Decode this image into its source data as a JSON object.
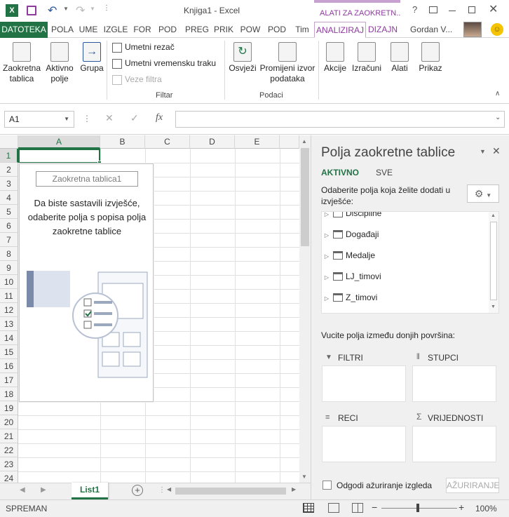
{
  "window": {
    "title": "Knjiga1 - Excel",
    "context_tab_group": "ALATI ZA ZAOKRETN...",
    "user": "Gordan V..."
  },
  "tabs": [
    "DATOTEKA",
    "POLA",
    "UME",
    "IZGLE",
    "FOR",
    "POD",
    "PREG",
    "PRIK",
    "POW",
    "POD",
    "Tim",
    "ANALIZIRAJ",
    "DIZAJN"
  ],
  "ribbon": {
    "pivot_table": "Zaokretna tablica",
    "active_field": "Aktivno polje",
    "group": "Grupa",
    "insert_slicer": "Umetni rezač",
    "insert_timeline": "Umetni vremensku traku",
    "filter_connections": "Veze filtra",
    "filter_group_label": "Filtar",
    "refresh": "Osvježi",
    "change_source": "Promijeni izvor podataka",
    "data_group_label": "Podaci",
    "actions": "Akcije",
    "calculations": "Izračuni",
    "tools": "Alati",
    "show": "Prikaz"
  },
  "formula_bar": {
    "name_box": "A1",
    "fx": "fx",
    "formula": ""
  },
  "grid": {
    "columns": [
      "A",
      "B",
      "C",
      "D",
      "E"
    ],
    "rows": [
      "1",
      "2",
      "3",
      "4",
      "5",
      "6",
      "7",
      "8",
      "9",
      "10",
      "11",
      "12",
      "13",
      "14",
      "15",
      "16",
      "17",
      "18",
      "19",
      "20",
      "21",
      "22",
      "23",
      "24"
    ]
  },
  "pivot_placeholder": {
    "name": "Zaokretna tablica1",
    "instructions": "Da biste sastavili izvješće, odaberite polja s popisa polja zaokretne tablice"
  },
  "sheet_tabs": {
    "active": "List1"
  },
  "status": {
    "mode": "SPREMAN",
    "zoom": "100%"
  },
  "field_list": {
    "title": "Polja zaokretne tablice",
    "tab_active": "AKTIVNO",
    "tab_all": "SVE",
    "prompt": "Odaberite polja koja želite dodati u izvješće:",
    "fields": [
      "Discipline",
      "Događaji",
      "Medalje",
      "LJ_timovi",
      "Z_timovi"
    ],
    "drag_prompt": "Vucite polja između donjih površina:",
    "areas": {
      "filters": "FILTRI",
      "columns": "STUPCI",
      "rows": "RECI",
      "values": "VRIJEDNOSTI"
    },
    "defer_label": "Odgodi ažuriranje izgleda",
    "update_button": "AŽURIRANJE"
  }
}
